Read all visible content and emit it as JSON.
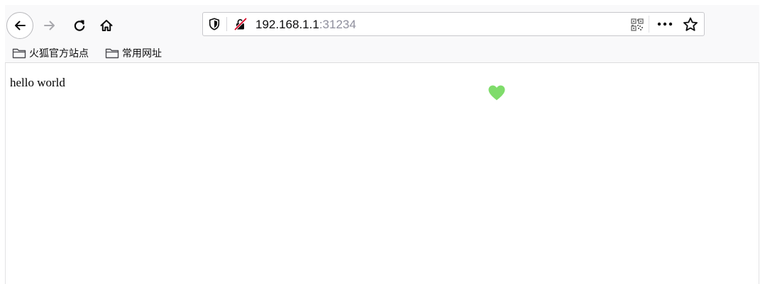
{
  "toolbar": {
    "back_icon": "back-arrow-icon",
    "forward_icon": "forward-arrow-icon",
    "reload_icon": "reload-icon",
    "home_icon": "home-icon"
  },
  "urlbar": {
    "host": "192.168.1.1",
    "port": ":31234",
    "shield_icon": "tracking-protection-shield-icon",
    "insecure_icon": "insecure-connection-icon",
    "qr_icon": "qr-code-icon",
    "more_icon": "page-actions-more-icon",
    "bookmark_icon": "bookmark-star-icon",
    "insecure_color": "#d70022"
  },
  "bookmarks": [
    {
      "label": "火狐官方站点",
      "icon": "folder-icon"
    },
    {
      "label": "常用网址",
      "icon": "folder-icon"
    }
  ],
  "page": {
    "text": "hello world",
    "heart_icon": "heart-icon",
    "heart_color": "#7fdc6b"
  }
}
